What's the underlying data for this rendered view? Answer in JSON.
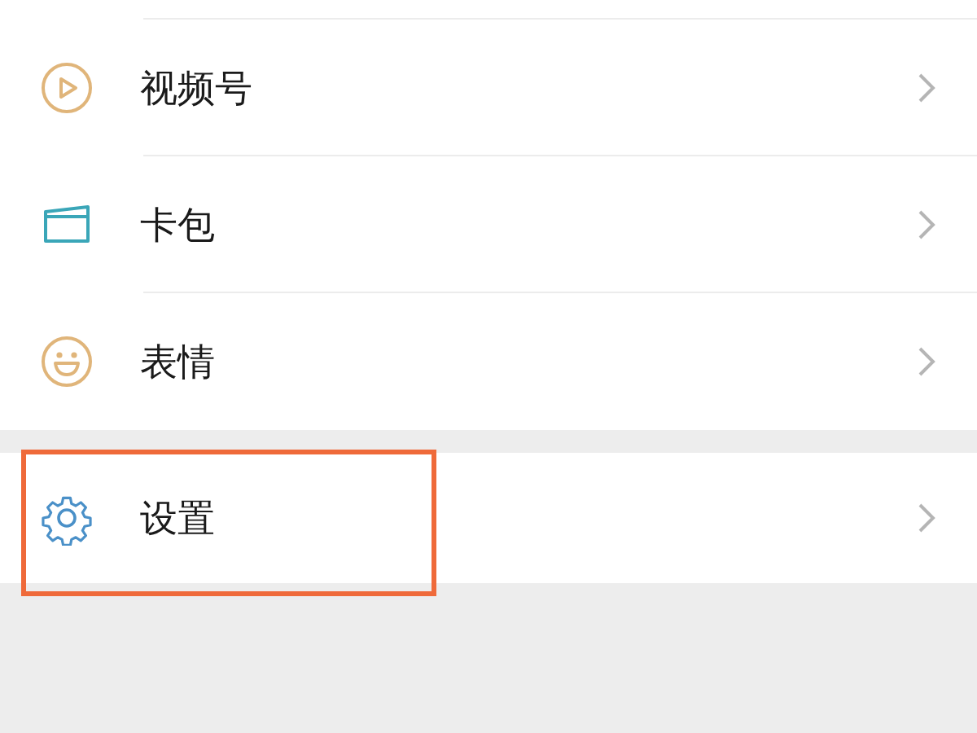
{
  "groups": [
    {
      "items": [
        {
          "kind": "video",
          "label": "视频号",
          "highlighted": false
        },
        {
          "kind": "cards",
          "label": "卡包",
          "highlighted": false
        },
        {
          "kind": "sticker",
          "label": "表情",
          "highlighted": false
        }
      ]
    },
    {
      "items": [
        {
          "kind": "settings",
          "label": "设置",
          "highlighted": true
        }
      ]
    }
  ]
}
